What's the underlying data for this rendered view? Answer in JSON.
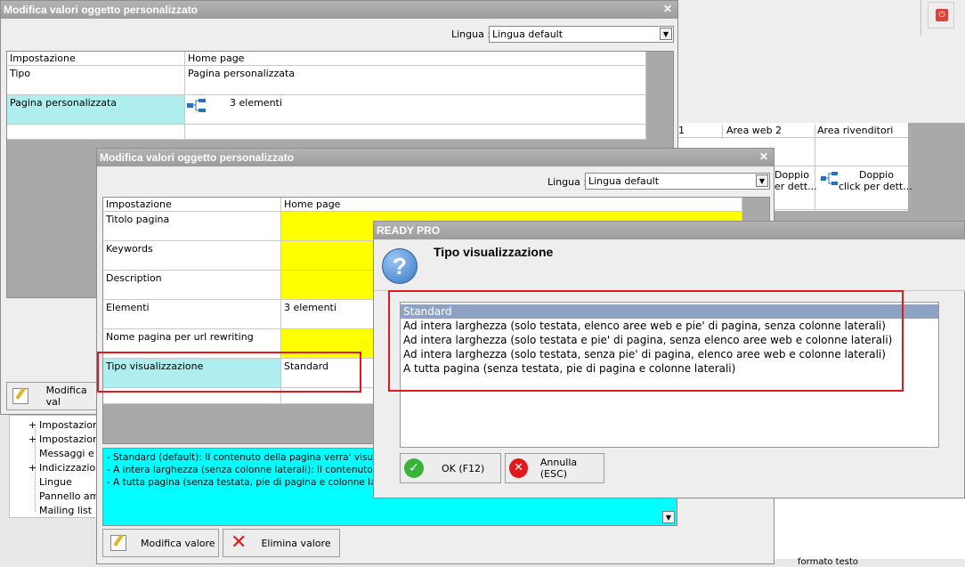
{
  "background": {
    "power_icon": "power-icon",
    "tree_items": [
      {
        "prefix": "+",
        "label": "Impostazioni"
      },
      {
        "prefix": "+",
        "label": "Impostazioni"
      },
      {
        "prefix": "",
        "label": "Messaggi e te"
      },
      {
        "prefix": "+",
        "label": "Indicizzazione"
      },
      {
        "prefix": "",
        "label": "Lingue"
      },
      {
        "prefix": "",
        "label": "Pannello amm"
      },
      {
        "prefix": "",
        "label": "Mailing list"
      }
    ],
    "table_headers": [
      "1",
      "Area web 2",
      "Area rivenditori"
    ],
    "doppio_1": "Doppio",
    "doppio_1b": "er dett...",
    "doppio_2": "Doppio",
    "doppio_2b": "click per dett...",
    "formato_testo": "formato testo"
  },
  "win1": {
    "title": "Modifica valori oggetto personalizzato",
    "lingua_label": "Lingua :",
    "lingua_value": "Lingua default",
    "col_impostazione": "Impostazione",
    "col_home": "Home page",
    "rows": [
      {
        "name": "Tipo",
        "value": "Pagina personalizzata"
      },
      {
        "name": "Pagina personalizzata",
        "value": "3 elementi"
      }
    ],
    "modifica_btn": "Modifica val"
  },
  "win2": {
    "title": "Modifica valori oggetto personalizzato",
    "lingua_label": "Lingua :",
    "lingua_value": "Lingua default",
    "col_impostazione": "Impostazione",
    "col_home": "Home page",
    "rows": [
      {
        "name": "Titolo pagina",
        "value": ""
      },
      {
        "name": "Keywords",
        "value": ""
      },
      {
        "name": "Description",
        "value": ""
      },
      {
        "name": "Elementi",
        "value": "3 elementi"
      },
      {
        "name": "Nome pagina per url rewriting",
        "value": ""
      },
      {
        "name": "Tipo visualizzazione",
        "value": "Standard"
      }
    ],
    "desc_lines": [
      "- Standard (default): Il contenuto della pagina verra' visualizz",
      "- A intera larghezza (senza colonne laterali): Il contenuto della",
      "- A tutta pagina (senza testata, pie di pagina e colonne laterali)"
    ],
    "modifica_btn": "Modifica valore",
    "elimina_btn": "Elimina valore"
  },
  "dialog": {
    "title": "READY PRO",
    "heading": "Tipo visualizzazione",
    "options": [
      "Standard",
      "Ad intera larghezza (solo testata, elenco aree web e pie' di pagina, senza colonne laterali)",
      "Ad intera larghezza (solo testata e pie' di pagina, senza elenco aree web e colonne laterali)",
      "Ad intera larghezza (solo testata, senza pie' di pagina, elenco aree web e colonne laterali)",
      "A tutta pagina (senza testata, pie di pagina e colonne laterali)"
    ],
    "selected_index": 0,
    "ok_btn": "OK (F12)",
    "cancel_btn": "Annulla (ESC)"
  },
  "colors": {
    "accent_yellow": "#ffff00",
    "accent_cyan": "#00ffff",
    "row_cyan": "#aeeeee",
    "highlight_red": "#e0191e",
    "selection": "#8ea2c4"
  }
}
